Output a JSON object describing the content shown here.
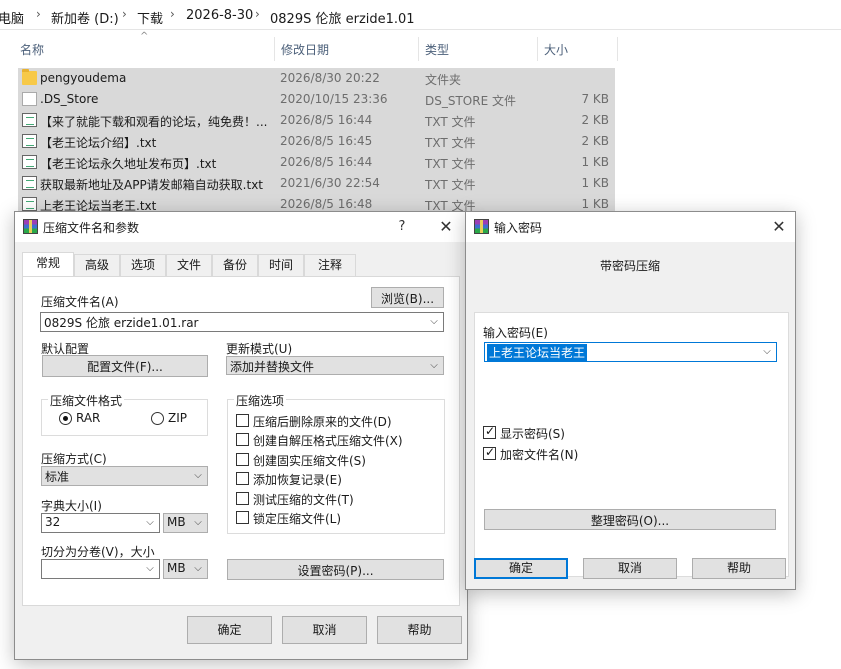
{
  "breadcrumb": [
    "电脑",
    "新加卷 (D:)",
    "下载",
    "2026-8-30",
    "0829S 伦旅 erzide1.01"
  ],
  "breadcrumb_sep": "›",
  "columns": {
    "name": "名称",
    "date": "修改日期",
    "type": "类型",
    "size": "大小"
  },
  "files": [
    {
      "icon": "folder-icon",
      "name": "pengyoudema",
      "date": "2026/8/30 20:22",
      "type": "文件夹",
      "size": ""
    },
    {
      "icon": "file-icon",
      "name": ".DS_Store",
      "date": "2020/10/15 23:36",
      "type": "DS_STORE 文件",
      "size": "7 KB"
    },
    {
      "icon": "text-file-icon",
      "name": "【来了就能下载和观看的论坛，纯免费！...",
      "date": "2026/8/5 16:44",
      "type": "TXT 文件",
      "size": "2 KB"
    },
    {
      "icon": "text-file-icon",
      "name": "【老王论坛介绍】.txt",
      "date": "2026/8/5 16:45",
      "type": "TXT 文件",
      "size": "2 KB"
    },
    {
      "icon": "text-file-icon",
      "name": "【老王论坛永久地址发布页】.txt",
      "date": "2026/8/5 16:44",
      "type": "TXT 文件",
      "size": "1 KB"
    },
    {
      "icon": "text-file-icon",
      "name": "获取最新地址及APP请发邮箱自动获取.txt",
      "date": "2021/6/30 22:54",
      "type": "TXT 文件",
      "size": "1 KB"
    },
    {
      "icon": "text-file-icon",
      "name": "上老王论坛当老王.txt",
      "date": "2026/8/5 16:48",
      "type": "TXT 文件",
      "size": "1 KB"
    }
  ],
  "archive_dialog": {
    "title": "压缩文件名和参数",
    "help_glyph": "?",
    "close_glyph": "✕",
    "tabs": [
      "常规",
      "高级",
      "选项",
      "文件",
      "备份",
      "时间",
      "注释"
    ],
    "archive_name_label": "压缩文件名(A)",
    "browse_button": "浏览(B)...",
    "archive_name_value": "0829S 伦旅 erzide1.01.rar",
    "default_profile_label": "默认配置",
    "profile_button": "配置文件(F)...",
    "update_mode_label": "更新模式(U)",
    "update_mode_value": "添加并替换文件",
    "format_group_title": "压缩文件格式",
    "format_rar": "RAR",
    "format_zip": "ZIP",
    "options_group_title": "压缩选项",
    "options": [
      {
        "label": "压缩后删除原来的文件(D)",
        "checked": false
      },
      {
        "label": "创建自解压格式压缩文件(X)",
        "checked": false
      },
      {
        "label": "创建固实压缩文件(S)",
        "checked": false
      },
      {
        "label": "添加恢复记录(E)",
        "checked": false
      },
      {
        "label": "测试压缩的文件(T)",
        "checked": false
      },
      {
        "label": "锁定压缩文件(L)",
        "checked": false
      }
    ],
    "method_label": "压缩方式(C)",
    "method_value": "标准",
    "dict_label": "字典大小(I)",
    "dict_value": "32",
    "dict_unit": "MB",
    "split_label": "切分为分卷(V)，大小",
    "split_value": "",
    "split_unit": "MB",
    "set_password_button": "设置密码(P)...",
    "ok_button": "确定",
    "cancel_button": "取消",
    "help_button": "帮助"
  },
  "password_dialog": {
    "title": "输入密码",
    "close_glyph": "✕",
    "heading": "带密码压缩",
    "password_label": "输入密码(E)",
    "password_value": "上老王论坛当老王",
    "show_password_label": "显示密码(S)",
    "show_password_checked": true,
    "encrypt_names_label": "加密文件名(N)",
    "encrypt_names_checked": true,
    "organize_button": "整理密码(O)...",
    "ok_button": "确定",
    "cancel_button": "取消",
    "help_button": "帮助"
  },
  "dropdown_glyph": "⌵",
  "sort_glyph": "^",
  "colors": {
    "selection": "#d9d9d9",
    "accent": "#0078d7",
    "dialog_bg": "#f0f0f0"
  }
}
